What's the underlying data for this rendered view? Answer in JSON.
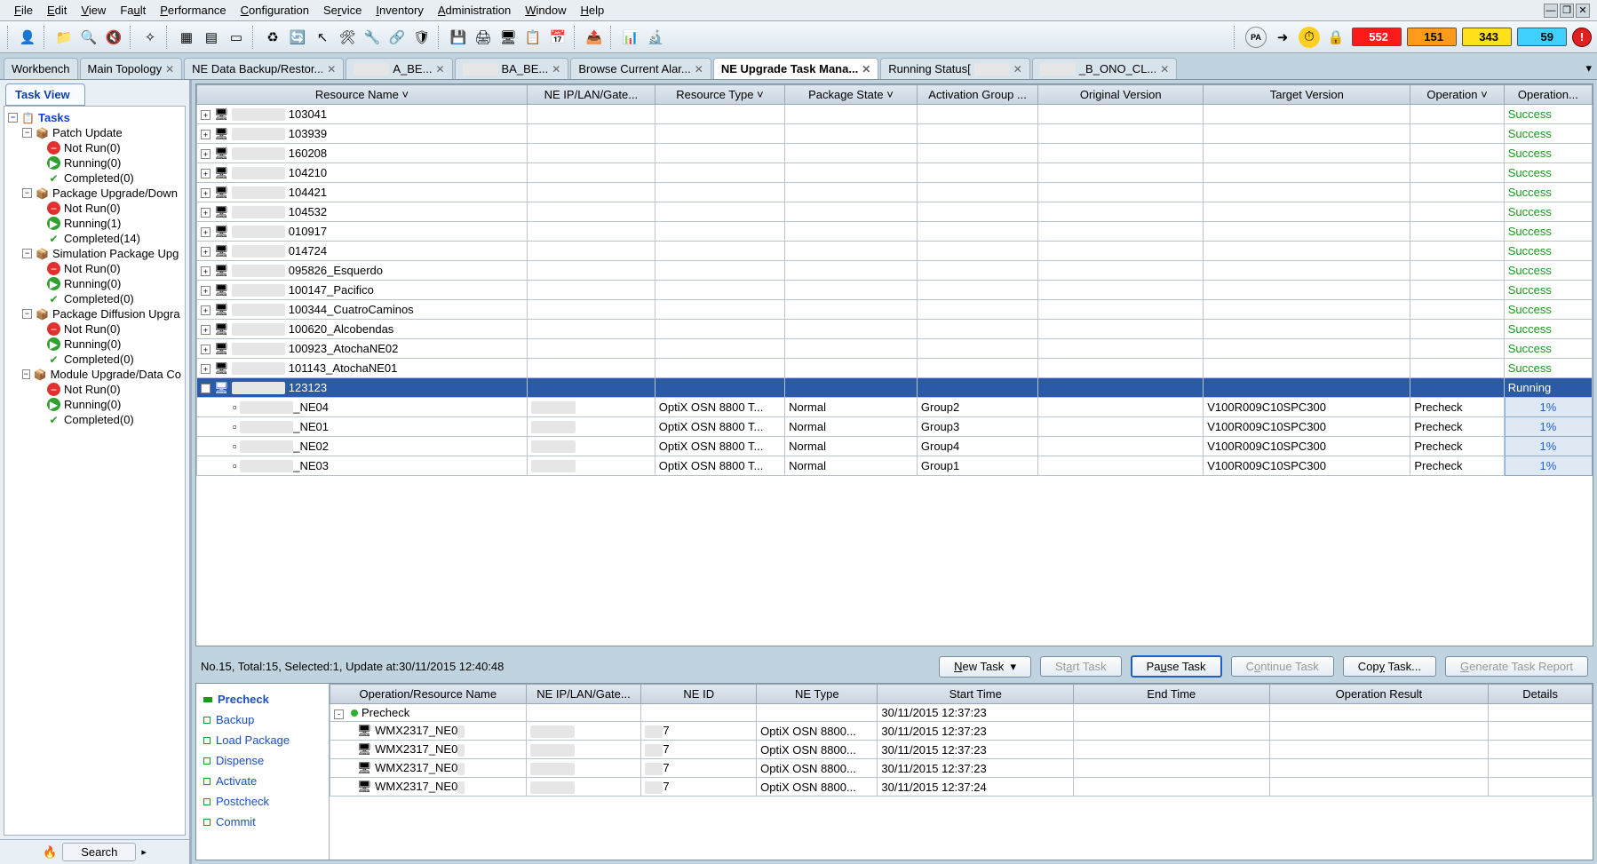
{
  "menu": [
    "File",
    "Edit",
    "View",
    "Fault",
    "Performance",
    "Configuration",
    "Service",
    "Inventory",
    "Administration",
    "Window",
    "Help"
  ],
  "counters": {
    "red": "552",
    "orange": "151",
    "yellow": "343",
    "cyan": "59"
  },
  "tabs": [
    {
      "label": "Workbench",
      "close": false
    },
    {
      "label": "Main Topology",
      "close": true
    },
    {
      "label": "NE Data Backup/Restor...",
      "close": true
    },
    {
      "label": "A_BE...",
      "close": true,
      "redactLeft": true
    },
    {
      "label": "BA_BE...",
      "close": true,
      "redactLeft": true
    },
    {
      "label": "Browse Current Alar...",
      "close": true
    },
    {
      "label": "NE Upgrade Task Mana...",
      "close": true,
      "active": true
    },
    {
      "label": "Running Status[",
      "close": true,
      "redactRight": true
    },
    {
      "label": "_B_ONO_CL...",
      "close": true,
      "redactLeft": true
    }
  ],
  "taskViewLabel": "Task View",
  "tree": {
    "root": "Tasks",
    "groups": [
      {
        "label": "Patch Update",
        "children": [
          {
            "kind": "notrun",
            "label": "Not Run(0)"
          },
          {
            "kind": "running",
            "label": "Running(0)"
          },
          {
            "kind": "completed",
            "label": "Completed(0)"
          }
        ]
      },
      {
        "label": "Package Upgrade/Down",
        "children": [
          {
            "kind": "notrun",
            "label": "Not Run(0)"
          },
          {
            "kind": "running",
            "label": "Running(1)"
          },
          {
            "kind": "completed",
            "label": "Completed(14)"
          }
        ]
      },
      {
        "label": "Simulation Package Upg",
        "children": [
          {
            "kind": "notrun",
            "label": "Not Run(0)"
          },
          {
            "kind": "running",
            "label": "Running(0)"
          },
          {
            "kind": "completed",
            "label": "Completed(0)"
          }
        ]
      },
      {
        "label": "Package Diffusion Upgra",
        "children": [
          {
            "kind": "notrun",
            "label": "Not Run(0)"
          },
          {
            "kind": "running",
            "label": "Running(0)"
          },
          {
            "kind": "completed",
            "label": "Completed(0)"
          }
        ]
      },
      {
        "label": "Module Upgrade/Data Co",
        "children": [
          {
            "kind": "notrun",
            "label": "Not Run(0)"
          },
          {
            "kind": "running",
            "label": "Running(0)"
          },
          {
            "kind": "completed",
            "label": "Completed(0)"
          }
        ]
      }
    ]
  },
  "searchButton": "Search",
  "mainGrid": {
    "columns": [
      "Resource Name ˅",
      "NE IP/LAN/Gate...",
      "Resource Type ˅",
      "Package State ˅",
      "Activation Group ...",
      "Original Version",
      "Target Version",
      "Operation ˅",
      "Operation..."
    ],
    "rows": [
      {
        "exp": "+",
        "name": "103041",
        "status": "Success"
      },
      {
        "exp": "+",
        "name": "103939",
        "status": "Success"
      },
      {
        "exp": "+",
        "name": "160208",
        "status": "Success"
      },
      {
        "exp": "+",
        "name": "104210",
        "status": "Success"
      },
      {
        "exp": "+",
        "name": "104421",
        "status": "Success"
      },
      {
        "exp": "+",
        "name": "104532",
        "status": "Success"
      },
      {
        "exp": "+",
        "name": "010917",
        "status": "Success"
      },
      {
        "exp": "+",
        "name": "014724",
        "status": "Success"
      },
      {
        "exp": "+",
        "name": "095826_Esquerdo",
        "status": "Success"
      },
      {
        "exp": "+",
        "name": "100147_Pacifico",
        "status": "Success"
      },
      {
        "exp": "+",
        "name": "100344_CuatroCaminos",
        "status": "Success"
      },
      {
        "exp": "+",
        "name": "100620_Alcobendas",
        "status": "Success"
      },
      {
        "exp": "+",
        "name": "100923_AtochaNE02",
        "status": "Success"
      },
      {
        "exp": "+",
        "name": "101143_AtochaNE01",
        "status": "Success"
      },
      {
        "exp": "-",
        "name": "123123",
        "status": "Running",
        "selected": true
      },
      {
        "child": true,
        "name": "_NE04",
        "rtype": "OptiX OSN 8800 T...",
        "pkg": "Normal",
        "group": "Group2",
        "target": "V100R009C10SPC300",
        "op": "Precheck",
        "progress": "1%"
      },
      {
        "child": true,
        "name": "_NE01",
        "rtype": "OptiX OSN 8800 T...",
        "pkg": "Normal",
        "group": "Group3",
        "target": "V100R009C10SPC300",
        "op": "Precheck",
        "progress": "1%"
      },
      {
        "child": true,
        "name": "_NE02",
        "rtype": "OptiX OSN 8800 T...",
        "pkg": "Normal",
        "group": "Group4",
        "target": "V100R009C10SPC300",
        "op": "Precheck",
        "progress": "1%"
      },
      {
        "child": true,
        "name": "_NE03",
        "rtype": "OptiX OSN 8800 T...",
        "pkg": "Normal",
        "group": "Group1",
        "target": "V100R009C10SPC300",
        "op": "Precheck",
        "progress": "1%"
      }
    ]
  },
  "actionBar": {
    "info": "No.15, Total:15, Selected:1, Update at:30/11/2015 12:40:48",
    "buttons": {
      "new": "New Task  ▾",
      "start": "Start Task",
      "pause": "Pause Task",
      "cont": "Continue Task",
      "copy": "Copy Task...",
      "report": "Generate Task Report"
    }
  },
  "steps": [
    "Precheck",
    "Backup",
    "Load Package",
    "Dispense",
    "Activate",
    "Postcheck",
    "Commit"
  ],
  "activeStep": 0,
  "detailGrid": {
    "columns": [
      "Operation/Resource Name",
      "NE IP/LAN/Gate...",
      "NE ID",
      "NE Type",
      "Start Time",
      "End Time",
      "Operation Result",
      "Details"
    ],
    "rows": [
      {
        "exp": "-",
        "name": "Precheck",
        "start": "30/11/2015 12:37:23"
      },
      {
        "child": true,
        "name": "WMX2317_NE0",
        "neid": "7",
        "netype": "OptiX OSN 8800...",
        "start": "30/11/2015 12:37:23"
      },
      {
        "child": true,
        "name": "WMX2317_NE0",
        "neid": "7",
        "netype": "OptiX OSN 8800...",
        "start": "30/11/2015 12:37:23"
      },
      {
        "child": true,
        "name": "WMX2317_NE0",
        "neid": "7",
        "netype": "OptiX OSN 8800...",
        "start": "30/11/2015 12:37:23"
      },
      {
        "child": true,
        "name": "WMX2317_NE0",
        "neid": "7",
        "netype": "OptiX OSN 8800...",
        "start": "30/11/2015 12:37:24"
      }
    ]
  }
}
